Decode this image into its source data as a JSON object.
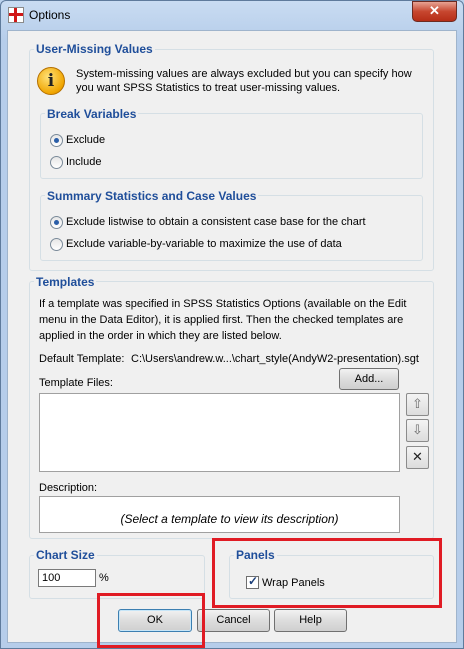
{
  "window": {
    "title": "Options",
    "close_glyph": "✕"
  },
  "user_missing": {
    "legend": "User-Missing Values",
    "info_text_1": "System-missing values are always excluded but you can specify how",
    "info_text_2": "you want SPSS Statistics to treat user-missing values.",
    "icon": "info-icon"
  },
  "break_variables": {
    "legend": "Break Variables",
    "options": [
      {
        "label": "Exclude",
        "selected": true
      },
      {
        "label": "Include",
        "selected": false
      }
    ]
  },
  "summary_stats": {
    "legend": "Summary Statistics and Case Values",
    "options": [
      {
        "label": "Exclude listwise to obtain a consistent case base for the chart",
        "selected": true
      },
      {
        "label": "Exclude variable-by-variable to maximize the use of data",
        "selected": false
      }
    ]
  },
  "templates": {
    "legend": "Templates",
    "desc_1": "If a template was specified in SPSS Statistics Options (available on the Edit",
    "desc_2": "menu in the Data Editor), it is applied first. Then the checked templates are",
    "desc_3": "applied in the order in which they are listed below.",
    "default_label": "Default Template:",
    "default_value": "C:\\Users\\andrew.w...\\chart_style(AndyW2-presentation).sgt",
    "files_label": "Template Files:",
    "add_label": "Add...",
    "description_label": "Description:",
    "description_placeholder": "(Select a template to view its description)"
  },
  "chart_size": {
    "legend": "Chart Size",
    "value": "100",
    "unit": "%"
  },
  "panels": {
    "legend": "Panels",
    "wrap_label": "Wrap Panels",
    "wrap_checked": true,
    "check_glyph": "✓"
  },
  "buttons": {
    "ok": "OK",
    "cancel": "Cancel",
    "help": "Help"
  },
  "colors": {
    "accent_text": "#1f4e9a",
    "highlight": "#e01b24"
  }
}
